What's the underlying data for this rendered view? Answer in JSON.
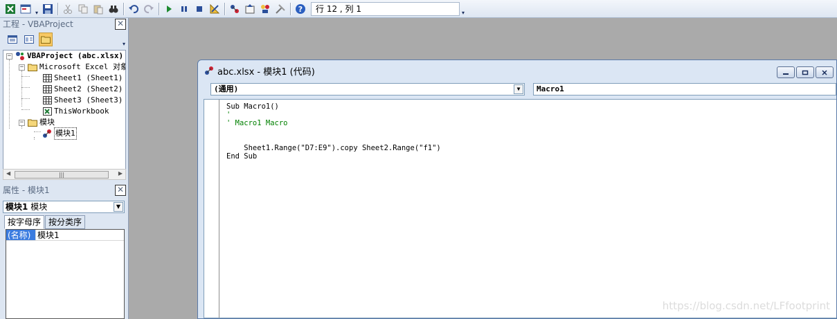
{
  "toolbar": {
    "status": "行 12 , 列 1"
  },
  "project_pane": {
    "title": "工程 - VBAProject",
    "tree": [
      {
        "label": "VBAProject (abc.xlsx)"
      },
      {
        "label": "Microsoft Excel 对象"
      },
      {
        "label": "Sheet1 (Sheet1)"
      },
      {
        "label": "Sheet2 (Sheet2)"
      },
      {
        "label": "Sheet3 (Sheet3)"
      },
      {
        "label": "ThisWorkbook"
      },
      {
        "label": "模块"
      },
      {
        "label": "模块1"
      }
    ],
    "expander_minus": "−"
  },
  "properties_pane": {
    "title": "属性 - 模块1",
    "object_name": "模块1",
    "object_type": "模块",
    "tabs": [
      "按字母序",
      "按分类序"
    ],
    "rows": [
      {
        "key": "(名称)",
        "value": "模块1"
      }
    ]
  },
  "code_window": {
    "title": "abc.xlsx - 模块1 (代码)",
    "object_combo": "(通用)",
    "proc_combo": "Macro1",
    "lines": [
      {
        "text": "Sub Macro1()",
        "kind": "code"
      },
      {
        "text": "'",
        "kind": "comment"
      },
      {
        "text": "' Macro1 Macro",
        "kind": "comment"
      },
      {
        "text": "",
        "kind": "code"
      },
      {
        "text": "",
        "kind": "code"
      },
      {
        "text": "    Sheet1.Range(\"D7:E9\").copy Sheet2.Range(\"f1\")",
        "kind": "code"
      },
      {
        "text": "End Sub",
        "kind": "code"
      }
    ]
  },
  "watermark": "https://blog.csdn.net/LFfootprint",
  "colors": {
    "selection": "#3b7ce0",
    "comment": "#008000"
  }
}
